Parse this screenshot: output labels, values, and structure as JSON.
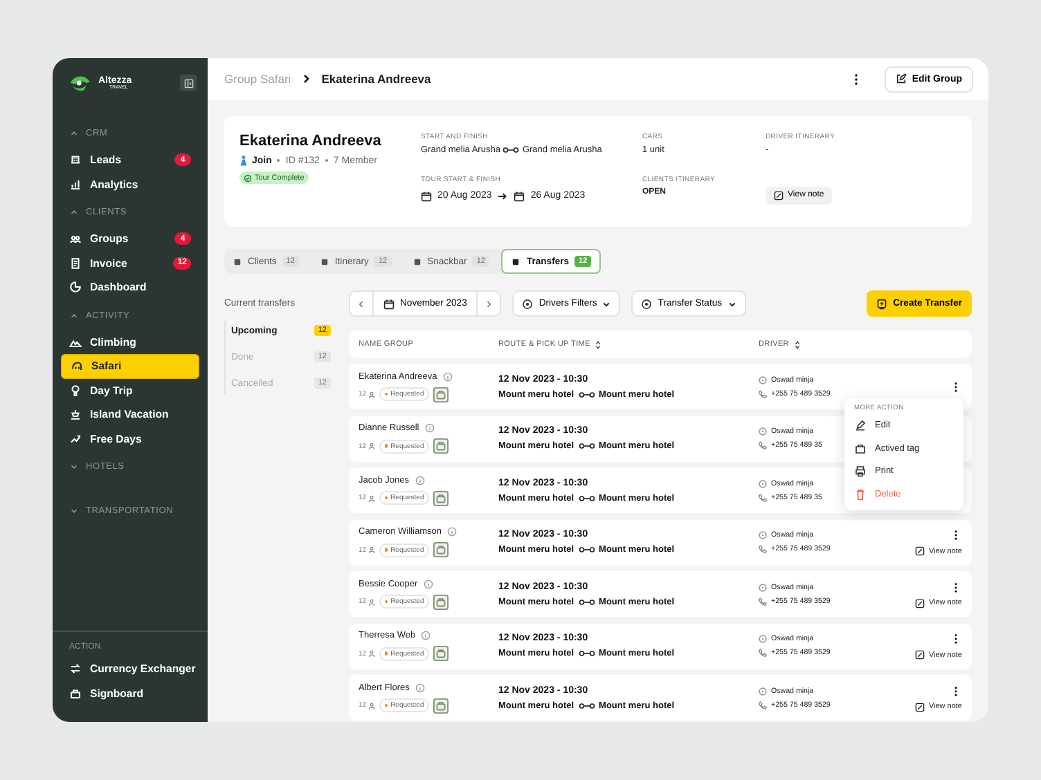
{
  "sidebar": {
    "logo": {
      "name": "Altezza",
      "sub": "TRAVEL"
    },
    "sections": [
      {
        "title": "CRM",
        "expanded": true,
        "items": [
          {
            "label": "Leads",
            "badge": "4",
            "selected": false
          },
          {
            "label": "Analytics",
            "selected": false
          }
        ]
      },
      {
        "title": "CLIENTS",
        "expanded": true,
        "items": [
          {
            "label": "Groups",
            "badge": "4",
            "selected": false
          },
          {
            "label": "Invoice",
            "badge": "12",
            "selected": false
          },
          {
            "label": "Dashboard",
            "selected": false
          }
        ]
      },
      {
        "title": "ACTIVITY",
        "expanded": true,
        "items": [
          {
            "label": "Climbing",
            "selected": false
          },
          {
            "label": "Safari",
            "selected": true
          },
          {
            "label": "Day Trip",
            "selected": false
          },
          {
            "label": "Island Vacation",
            "selected": false
          },
          {
            "label": "Free Days",
            "selected": false
          }
        ]
      },
      {
        "title": "HOTELS",
        "expanded": false
      },
      {
        "title": "TRANSPORTATION",
        "expanded": false
      }
    ],
    "action": {
      "title": "ACTION",
      "items": [
        {
          "label": "Currency Exchanger"
        },
        {
          "label": "Signboard"
        }
      ]
    }
  },
  "header": {
    "breadcrumb_parent": "Group Safari",
    "breadcrumb_current": "Ekaterina Andreeva",
    "edit_button": "Edit Group"
  },
  "profile": {
    "name": "Ekaterina Andreeva",
    "join": "Join",
    "id": "ID #132",
    "members": "7 Member",
    "status": "Tour Complete",
    "start_finish_label": "START AND FINISH",
    "start": "Grand melia Arusha",
    "finish": "Grand melia Arusha",
    "cars_label": "CARS",
    "cars": "1 unit",
    "driver_itinerary_label": "DRIVER ITINERARY",
    "driver_itinerary": "-",
    "tour_label": "TOUR START & FINISH",
    "tour_start": "20 Aug 2023",
    "tour_end": "26 Aug 2023",
    "clients_itinerary_label": "CLIENTS ITINERARY",
    "clients_itinerary": "OPEN",
    "view_note": "View note"
  },
  "tabs": [
    {
      "label": "Clients",
      "count": "12",
      "selected": false
    },
    {
      "label": "Itinerary",
      "count": "12",
      "selected": false
    },
    {
      "label": "Snackbar",
      "count": "12",
      "selected": false
    },
    {
      "label": "Transfers",
      "count": "12",
      "selected": true
    }
  ],
  "subnav": {
    "title": "Current transfers",
    "items": [
      {
        "label": "Upcoming",
        "count": "12",
        "selected": true
      },
      {
        "label": "Done",
        "count": "12",
        "selected": false
      },
      {
        "label": "Cancelled",
        "count": "12",
        "selected": false
      }
    ]
  },
  "toolbar": {
    "month": "November 2023",
    "filters": [
      "Drivers Filters",
      "Transfer Status"
    ],
    "create_button": "Create Transfer"
  },
  "table": {
    "columns": [
      "NAME GROUP",
      "ROUTE & PICK UP TIME",
      "DRIVER"
    ],
    "rows": [
      {
        "name": "Ekaterina Andreeva",
        "count": "12",
        "status": "Requested",
        "time": "12 Nov 2023 - 10:30",
        "from": "Mount meru hotel",
        "to": "Mount meru hotel",
        "driver": "Oswad minja",
        "phone": "+255 75 489 3529",
        "more_button": true
      },
      {
        "name": "Dianne Russell",
        "count": "12",
        "status": "Requested",
        "time": "12 Nov 2023 - 10:30",
        "from": "Mount meru hotel",
        "to": "Mount meru hotel",
        "driver": "Oswad minja",
        "phone": "+255 75 489 35",
        "more_button": false
      },
      {
        "name": "Jacob Jones",
        "count": "12",
        "status": "Requested",
        "time": "12 Nov 2023 - 10:30",
        "from": "Mount meru hotel",
        "to": "Mount meru hotel",
        "driver": "Oswad minja",
        "phone": "+255 75 489 35",
        "more_button": false
      },
      {
        "name": "Cameron Williamson",
        "count": "12",
        "status": "Requested",
        "time": "12 Nov 2023 - 10:30",
        "from": "Mount meru hotel",
        "to": "Mount meru hotel",
        "driver": "Oswad minja",
        "phone": "+255 75 489 3529",
        "more_button": true,
        "view_note": "View note"
      },
      {
        "name": "Bessie Cooper",
        "count": "12",
        "status": "Requested",
        "time": "12 Nov 2023 - 10:30",
        "from": "Mount meru hotel",
        "to": "Mount meru hotel",
        "driver": "Oswad minja",
        "phone": "+255 75 489 3529",
        "more_button": true,
        "view_note": "View note"
      },
      {
        "name": "Therresa Web",
        "count": "12",
        "status": "Requested",
        "time": "12 Nov 2023 - 10:30",
        "from": "Mount meru hotel",
        "to": "Mount meru hotel",
        "driver": "Oswad minja",
        "phone": "+255 75 489 3529",
        "more_button": true,
        "view_note": "View note"
      },
      {
        "name": "Albert Flores",
        "count": "12",
        "status": "Requested",
        "time": "12 Nov 2023 - 10:30",
        "from": "Mount meru hotel",
        "to": "Mount meru hotel",
        "driver": "Oswad minja",
        "phone": "+255 75 489 3529",
        "more_button": true,
        "view_note": "View note"
      }
    ]
  },
  "menu": {
    "title": "MORE ACTION",
    "items": [
      {
        "label": "Edit",
        "kind": "normal"
      },
      {
        "label": "Actived tag",
        "kind": "normal"
      },
      {
        "label": "Print",
        "kind": "normal"
      },
      {
        "label": "Delete",
        "kind": "danger"
      }
    ]
  }
}
